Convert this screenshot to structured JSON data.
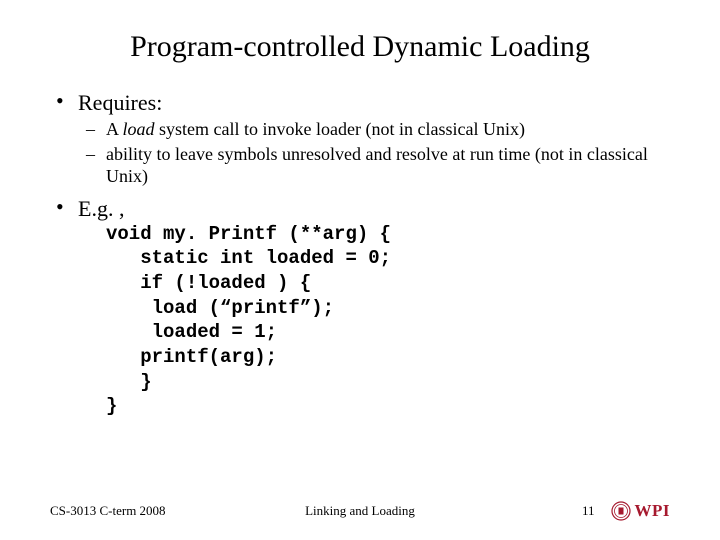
{
  "title": "Program-controlled Dynamic Loading",
  "bullets": {
    "requires": {
      "label": "Requires:",
      "sub1_pre": "A ",
      "sub1_em": "load",
      "sub1_post": " system call to invoke loader (not in classical Unix)",
      "sub2": "ability to leave symbols unresolved and resolve at run time (not in classical Unix)"
    },
    "eg": {
      "label": "E.g. ,",
      "code": "void my. Printf (**arg) {\n   static int loaded = 0;\n   if (!loaded ) {\n    load (“printf”);\n    loaded = 1;\n   printf(arg);\n   }\n}"
    }
  },
  "footer": {
    "left": "CS-3013 C-term 2008",
    "center": "Linking and Loading",
    "page": "11",
    "logo_text": "WPI"
  },
  "colors": {
    "brand": "#a6192e"
  }
}
